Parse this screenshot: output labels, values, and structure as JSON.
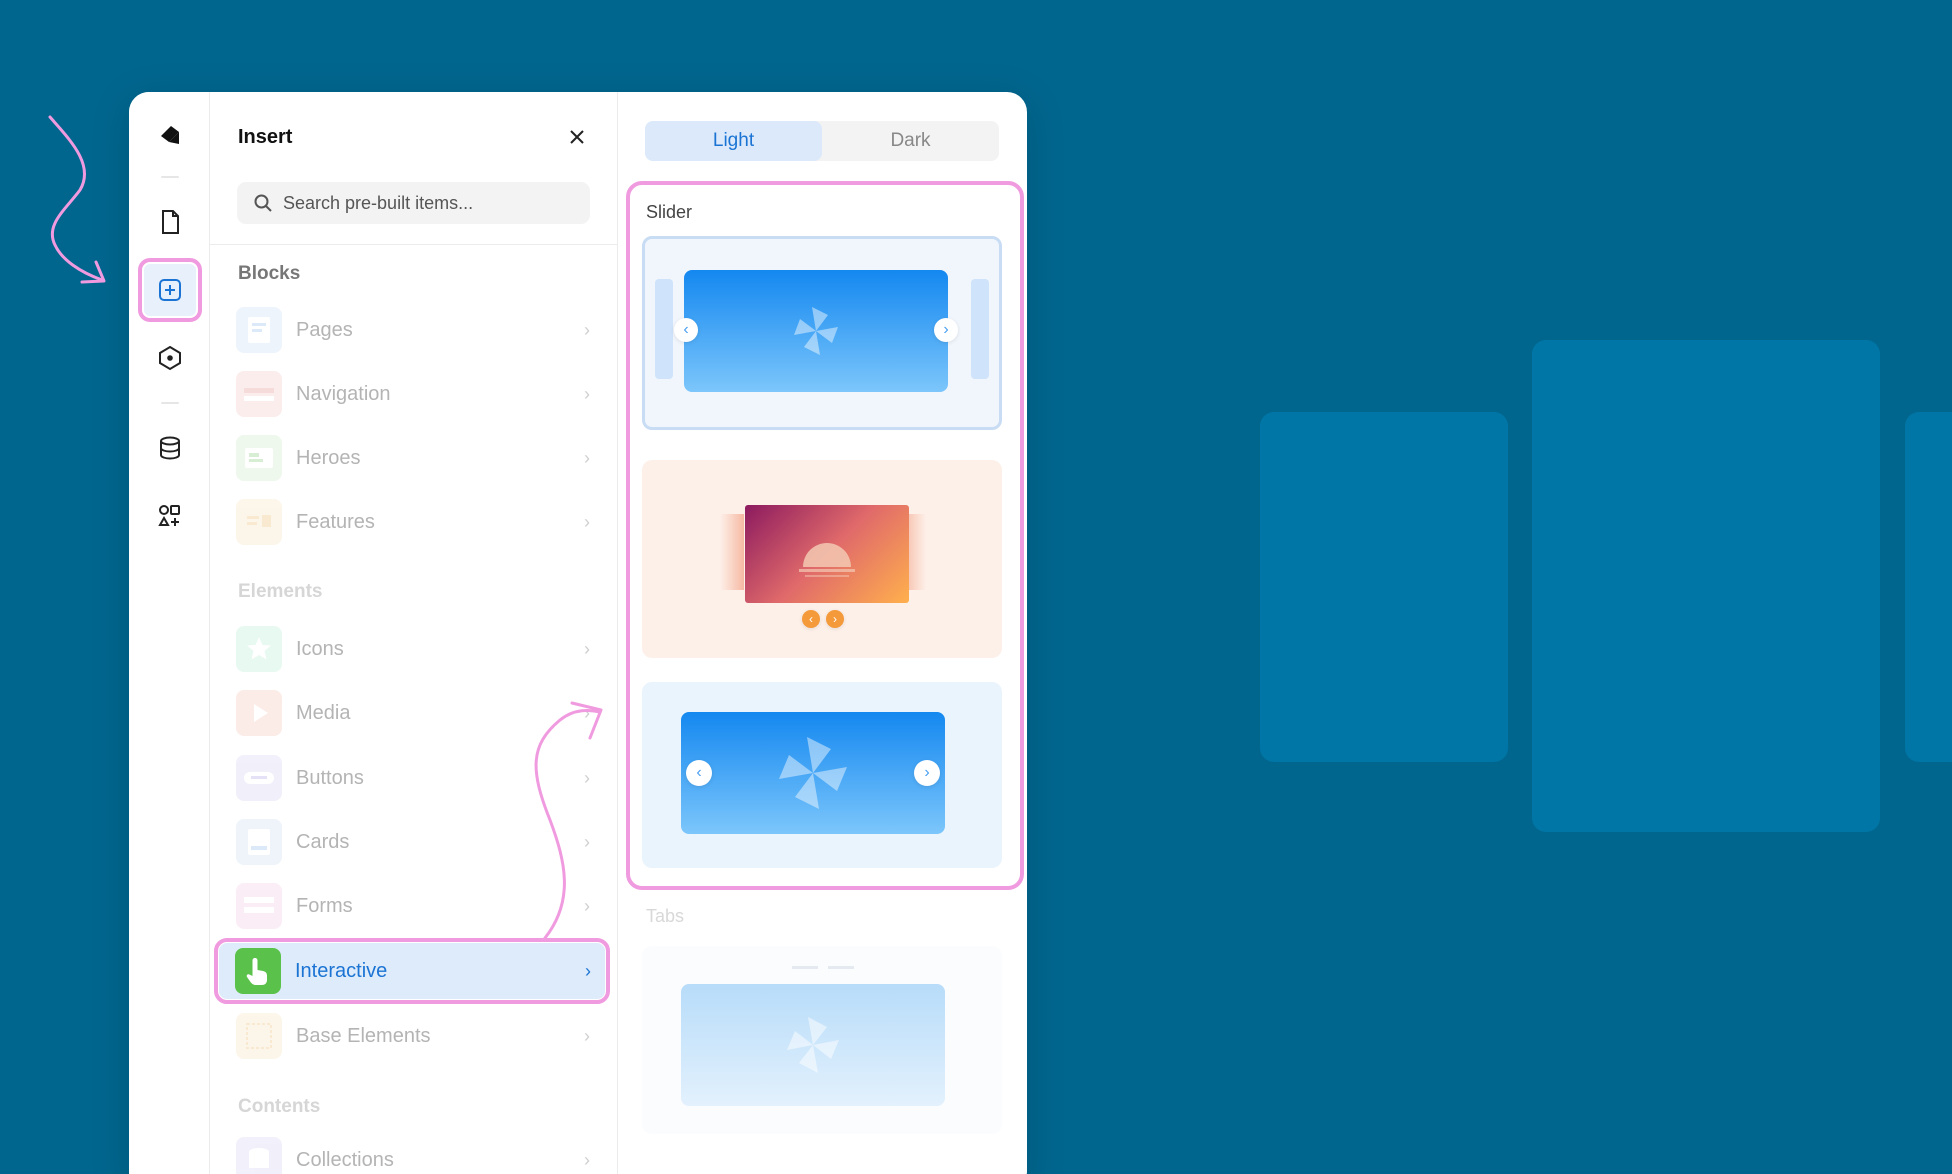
{
  "panel": {
    "title": "Insert",
    "search_placeholder": "Search pre-built items..."
  },
  "rail": {
    "items": [
      "logo-icon",
      "page-icon",
      "insert-icon",
      "component-icon",
      "database-icon",
      "assets-icon"
    ]
  },
  "sections": {
    "blocks": "Blocks",
    "elements": "Elements",
    "contents": "Contents"
  },
  "blocks": [
    {
      "label": "Pages",
      "color": "#cfe0f7"
    },
    {
      "label": "Navigation",
      "color": "#f7cccc"
    },
    {
      "label": "Heroes",
      "color": "#cfeccd"
    },
    {
      "label": "Features",
      "color": "#f8e4c4"
    }
  ],
  "elements": [
    {
      "label": "Icons",
      "color": "#bdeed8"
    },
    {
      "label": "Media",
      "color": "#f7cbbd"
    },
    {
      "label": "Buttons",
      "color": "#d9d3f3"
    },
    {
      "label": "Cards",
      "color": "#cfe0f3"
    },
    {
      "label": "Forms",
      "color": "#f6cde7"
    },
    {
      "label": "Interactive",
      "color": "#5ac24a"
    },
    {
      "label": "Base Elements",
      "color": "#f8e4c4"
    }
  ],
  "contents": [
    {
      "label": "Collections",
      "color": "#d9d3f3"
    }
  ],
  "theme_toggle": {
    "light": "Light",
    "dark": "Dark",
    "selected": "Light"
  },
  "preview": {
    "slider_label": "Slider",
    "tabs_label": "Tabs"
  },
  "colors": {
    "background": "#01668e",
    "accent": "#1b74d4",
    "highlight": "#f09adf"
  }
}
